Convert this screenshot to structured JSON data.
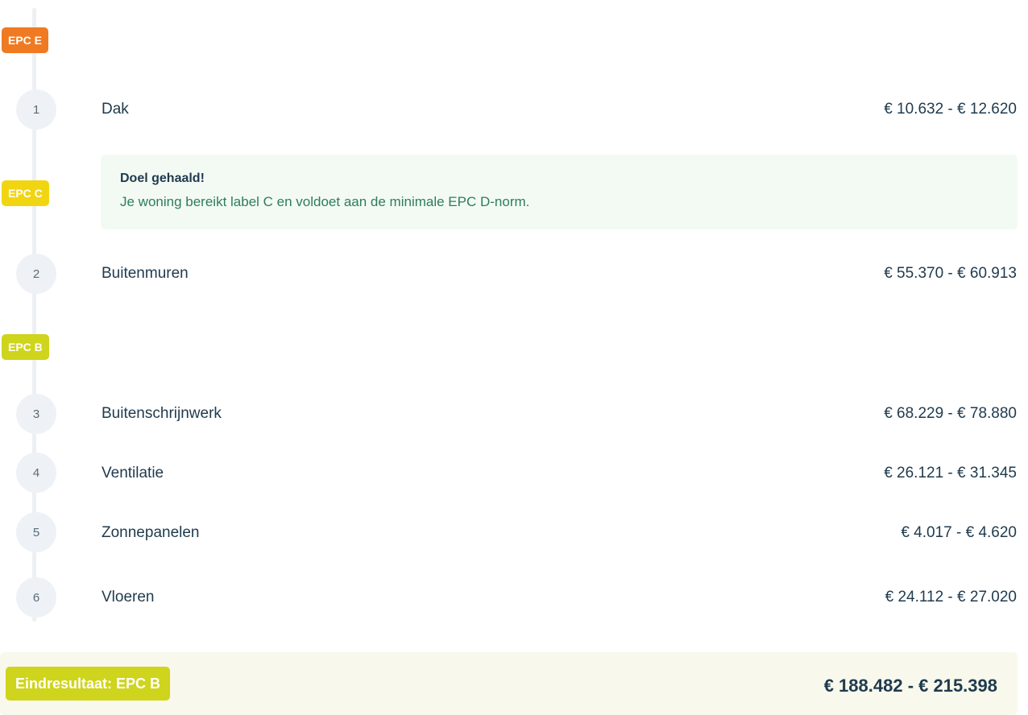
{
  "labels": {
    "epc_e": "EPC E",
    "epc_c": "EPC C",
    "epc_b": "EPC B"
  },
  "colors": {
    "epc_e": "#f07a22",
    "epc_c": "#f1d511",
    "epc_b": "#cfd41c",
    "result_bg": "#f8f8ec",
    "goal_bg": "#f3faf4",
    "goal_text": "#2e7d5b"
  },
  "steps": [
    {
      "number": "1",
      "label": "Dak",
      "price": "€ 10.632 - € 12.620"
    },
    {
      "number": "2",
      "label": "Buitenmuren",
      "price": "€ 55.370 - € 60.913"
    },
    {
      "number": "3",
      "label": "Buitenschrijnwerk",
      "price": "€ 68.229 - € 78.880"
    },
    {
      "number": "4",
      "label": "Ventilatie",
      "price": "€ 26.121 - € 31.345"
    },
    {
      "number": "5",
      "label": "Zonnepanelen",
      "price": "€ 4.017 - € 4.620"
    },
    {
      "number": "6",
      "label": "Vloeren",
      "price": "€ 24.112 - € 27.020"
    }
  ],
  "goal": {
    "title": "Doel gehaald!",
    "text": "Je woning bereikt label C en voldoet aan de minimale EPC D-norm."
  },
  "result": {
    "label": "Eindresultaat: EPC B",
    "price": "€ 188.482 - € 215.398"
  }
}
